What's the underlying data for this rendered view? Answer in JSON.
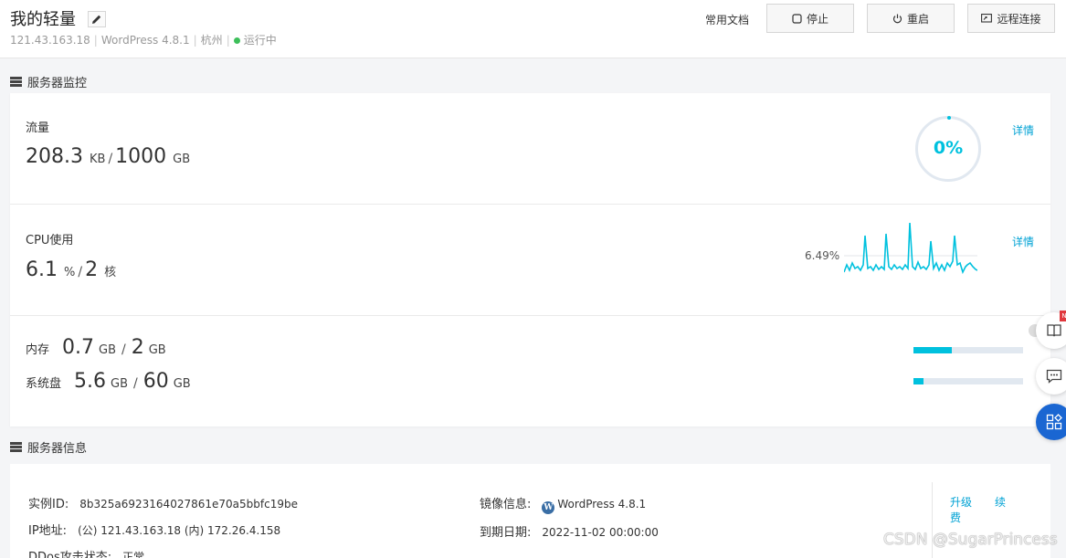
{
  "header": {
    "title": "我的轻量",
    "ip": "121.43.163.18",
    "app": "WordPress 4.8.1",
    "region": "杭州",
    "status": "运行中",
    "status_color": "#3dbf5a",
    "docs_label": "常用文档",
    "stop_label": "停止",
    "restart_label": "重启",
    "remote_label": "远程连接"
  },
  "monitor": {
    "section_title": "服务器监控",
    "traffic": {
      "label": "流量",
      "used": "208.3",
      "used_unit": "KB",
      "total": "1000",
      "total_unit": "GB",
      "percent_text": "0%",
      "percent_value": 0,
      "detail_label": "详情"
    },
    "cpu": {
      "label": "CPU使用",
      "used": "6.1",
      "used_unit": "%",
      "cores": "2",
      "cores_unit": "核",
      "spark_value": "6.49%",
      "detail_label": "详情"
    },
    "memory": {
      "label": "内存",
      "used": "0.7",
      "used_unit": "GB",
      "total": "2",
      "total_unit": "GB",
      "fraction": 0.35
    },
    "disk": {
      "label": "系统盘",
      "used": "5.6",
      "used_unit": "GB",
      "total": "60",
      "total_unit": "GB",
      "fraction": 0.093
    }
  },
  "info": {
    "section_title": "服务器信息",
    "instance_id_label": "实例ID:",
    "instance_id": "8b325a6923164027861e70a5bbfc19be",
    "ip_label": "IP地址:",
    "ip_value": "(公) 121.43.163.18 (内) 172.26.4.158",
    "ddos_label": "DDos攻击状态:",
    "ddos_value": "正常",
    "image_label": "镜像信息:",
    "image_value": "WordPress 4.8.1",
    "expire_label": "到期日期:",
    "expire_value": "2022-11-02 00:00:00",
    "upgrade_label": "升级",
    "renew_label_1": "续",
    "renew_label_2": "费"
  },
  "floating": {
    "new_badge": "N"
  },
  "watermark": "CSDN @SugarPrincess",
  "colors": {
    "accent": "#00c1de",
    "link": "#00a2d4",
    "float_blue": "#1a66d2"
  }
}
